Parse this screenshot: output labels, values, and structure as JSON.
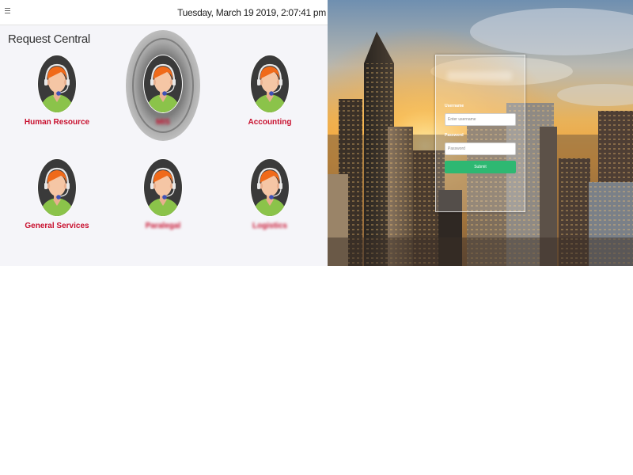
{
  "topbar": {
    "menu_icon": "hamburger-icon",
    "datetime": "Tuesday, March 19 2019, 2:07:41 pm"
  },
  "app": {
    "title": "Request Central",
    "departments": [
      {
        "label": "Human Resource",
        "icon": "support-agent-icon",
        "blurred": false
      },
      {
        "label": "MIS",
        "icon": "support-agent-icon",
        "blurred": true,
        "highlighted": true
      },
      {
        "label": "Accounting",
        "icon": "support-agent-icon",
        "blurred": false
      },
      {
        "label": "General Services",
        "icon": "support-agent-icon",
        "blurred": false
      },
      {
        "label": "Paralegal",
        "icon": "support-agent-icon",
        "blurred": true
      },
      {
        "label": "Logistics",
        "icon": "support-agent-icon",
        "blurred": true
      }
    ],
    "label_color": "#c8102e"
  },
  "login": {
    "username_label": "Username",
    "username_placeholder": "Enter username",
    "password_label": "Password",
    "password_placeholder": "Password",
    "submit_label": "Submit",
    "submit_color": "#2eb872"
  }
}
